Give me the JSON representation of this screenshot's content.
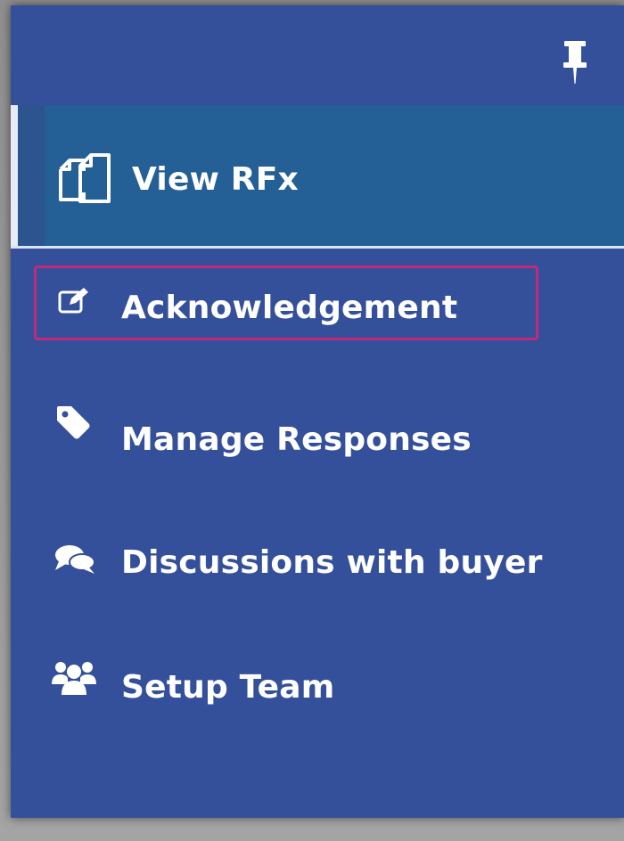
{
  "sidebar": {
    "pin_icon": "pin-icon",
    "items": [
      {
        "label": "View RFx",
        "icon": "copy-documents-icon",
        "active": true
      },
      {
        "label": "Acknowledgement",
        "icon": "edit-icon",
        "active": false
      },
      {
        "label": "Manage Responses",
        "icon": "tag-icon",
        "active": false
      },
      {
        "label": "Discussions with buyer",
        "icon": "comments-icon",
        "active": false
      },
      {
        "label": "Setup Team",
        "icon": "users-icon",
        "active": false
      }
    ]
  },
  "colors": {
    "panel": "#34509a",
    "active_item": "#245f95",
    "active_edge": "#e6edf4",
    "highlight_border": "#c12a79",
    "text": "#ffffff"
  }
}
